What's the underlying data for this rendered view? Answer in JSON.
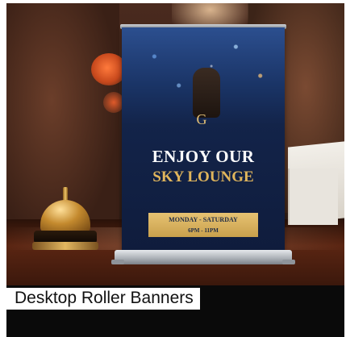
{
  "caption": "Desktop Roller Banners",
  "banner": {
    "logo": "G",
    "brand": "",
    "headline": "ENJOY OUR",
    "subheadline": "SKY LOUNGE",
    "tagline": "",
    "hours_days": "MONDAY - SATURDAY",
    "hours_time": "6PM - 11PM"
  },
  "colors": {
    "banner_bg": "#13244a",
    "accent_gold": "#e0b55c",
    "caption_bg": "#0a0a0a"
  }
}
